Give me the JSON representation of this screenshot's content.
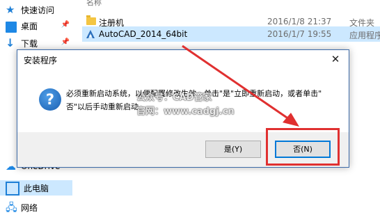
{
  "sidebar": {
    "items": [
      {
        "label": "快速访问",
        "icon": "star-icon"
      },
      {
        "label": "桌面",
        "icon": "desktop-icon"
      },
      {
        "label": "下载",
        "icon": "download-icon"
      },
      {
        "label": "OneDrive",
        "icon": "cloud-icon"
      },
      {
        "label": "此电脑",
        "icon": "computer-icon"
      },
      {
        "label": "网络",
        "icon": "network-icon"
      }
    ]
  },
  "file_list": {
    "header_name": "名称",
    "rows": [
      {
        "name": "注册机",
        "date": "2016/1/8 21:37",
        "type": "文件夹",
        "icon": "folder-icon"
      },
      {
        "name": "AutoCAD_2014_64bit",
        "date": "2016/1/7 19:55",
        "type": "应用程序",
        "icon": "autocad-icon"
      }
    ]
  },
  "dialog": {
    "title": "安装程序",
    "close_symbol": "✕",
    "icon": "question-icon",
    "message_line1": "必须重新启动系统，以便配置修改生效。单击\"是\"立即重新启动，或者单击\"",
    "message_line2": "否\"以后手动重新启动。",
    "yes_label": "是(Y)",
    "no_label": "否(N)"
  },
  "watermark": {
    "line1": "公众号：CAD管家",
    "line2": "官网：www.cadgj.cn"
  },
  "colors": {
    "highlight": "#e03030",
    "selection": "#cce8ff",
    "accent": "#0078d7"
  }
}
